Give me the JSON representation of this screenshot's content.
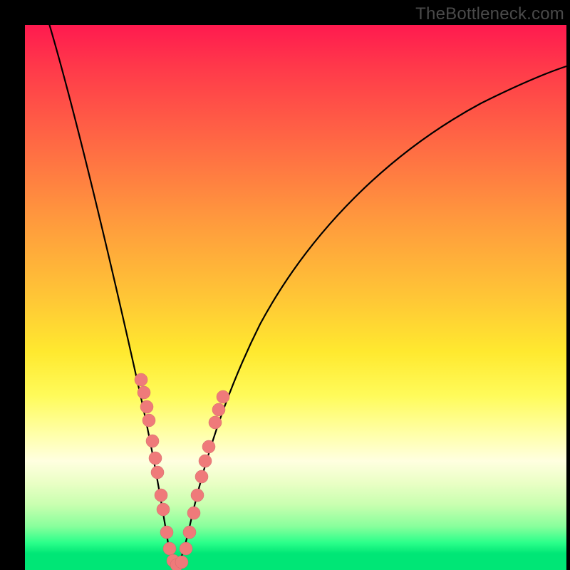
{
  "watermark": "TheBottleneck.com",
  "colors": {
    "frame": "#000000",
    "curve": "#000000",
    "markers_fill": "#ef7a7a",
    "markers_stroke": "#c95b5b",
    "gradient_top": "#ff1a4f",
    "gradient_bottom": "#00e676"
  },
  "chart_data": {
    "type": "line",
    "title": "",
    "xlabel": "",
    "ylabel": "",
    "xlim": [
      0,
      100
    ],
    "ylim": [
      0,
      100
    ],
    "note": "Axes are unlabeled in the image; x and y are normalized 0–100 estimates read from pixel positions. Curve minimum (best match / zero bottleneck) is near x≈27.",
    "series": [
      {
        "name": "bottleneck-curve",
        "x": [
          4,
          8,
          12,
          16,
          18,
          20,
          22,
          24,
          25,
          26,
          27,
          28,
          29,
          30,
          31,
          33,
          35,
          38,
          42,
          48,
          55,
          63,
          72,
          82,
          92,
          100
        ],
        "y": [
          100,
          84,
          68,
          52,
          45,
          38,
          30,
          18,
          11,
          5,
          1,
          2,
          6,
          11,
          18,
          28,
          37,
          47,
          57,
          67,
          75,
          81,
          86,
          90,
          93,
          95
        ]
      }
    ],
    "markers": {
      "name": "highlighted-points",
      "note": "Pink dots clustered on both arms near the valley",
      "x_estimate": [
        20.5,
        21.2,
        21.8,
        22.6,
        23.4,
        24.0,
        24.8,
        25.3,
        25.9,
        26.5,
        27.0,
        27.6,
        28.2,
        28.8,
        29.4,
        30.0,
        30.7,
        31.5,
        32.3,
        33.0
      ],
      "y_estimate": [
        36,
        33,
        30,
        26,
        22,
        18,
        13,
        10,
        7,
        4,
        1,
        2,
        5,
        8,
        12,
        16,
        20,
        24,
        28,
        32
      ]
    }
  }
}
